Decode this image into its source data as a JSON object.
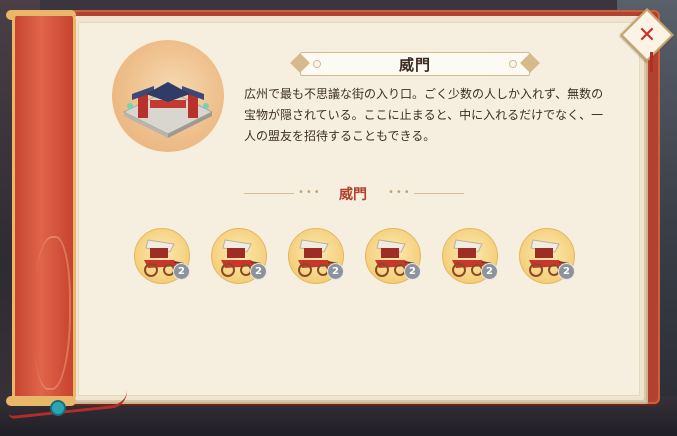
{
  "dialog": {
    "title": "威門",
    "description": "広州で最も不思議な街の入り口。ごく少数の人しか入れず、無数の宝物が隠されている。ここに止まると、中に入れるだけでなく、一人の盟友を招待することもできる。",
    "close_icon": "close-icon",
    "building_icon": "gate-building-icon"
  },
  "section": {
    "title": "威門"
  },
  "items": [
    {
      "icon": "cart-icon",
      "count": "2"
    },
    {
      "icon": "cart-icon",
      "count": "2"
    },
    {
      "icon": "cart-icon",
      "count": "2"
    },
    {
      "icon": "cart-icon",
      "count": "2"
    },
    {
      "icon": "cart-icon",
      "count": "2"
    },
    {
      "icon": "cart-icon",
      "count": "2"
    }
  ],
  "colors": {
    "cover": "#b2422f",
    "paper": "#f6efdf",
    "accent_red": "#b0402c",
    "item_gold": "#f4cf7a",
    "badge_gray": "#8d939c"
  }
}
